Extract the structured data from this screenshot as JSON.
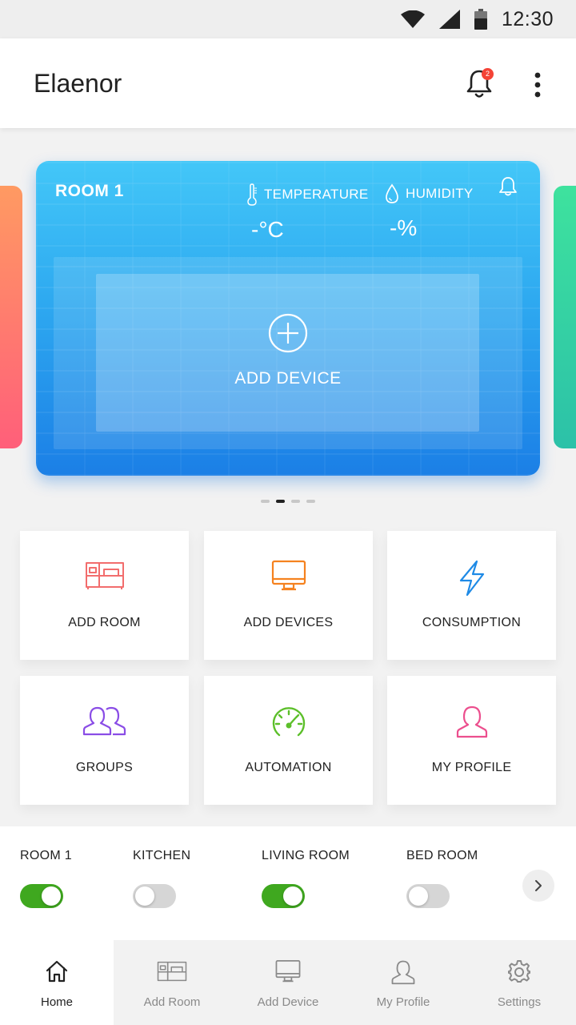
{
  "status_bar": {
    "time": "12:30",
    "icons": [
      "wifi-icon",
      "signal-icon",
      "battery-icon"
    ]
  },
  "app_bar": {
    "title": "Elaenor",
    "notification_count": "2"
  },
  "room_card": {
    "name": "ROOM 1",
    "temperature_label": "TEMPERATURE",
    "temperature_value": "-°C",
    "humidity_label": "HUMIDITY",
    "humidity_value": "-%",
    "add_device_label": "ADD DEVICE"
  },
  "carousel": {
    "pages": 4,
    "active_index": 1
  },
  "tiles": [
    {
      "label": "ADD ROOM",
      "icon": "bed-icon",
      "color": "#f26d6d"
    },
    {
      "label": "ADD DEVICES",
      "icon": "monitor-icon",
      "color": "#f5821f"
    },
    {
      "label": "CONSUMPTION",
      "icon": "lightning-icon",
      "color": "#1e8ae6"
    },
    {
      "label": "GROUPS",
      "icon": "group-icon",
      "color": "#8a4de6"
    },
    {
      "label": "AUTOMATION",
      "icon": "speedometer-icon",
      "color": "#5cbf2a"
    },
    {
      "label": "MY PROFILE",
      "icon": "user-icon",
      "color": "#ec4f8e"
    }
  ],
  "room_toggles": [
    {
      "label": "ROOM 1",
      "on": true
    },
    {
      "label": "KITCHEN",
      "on": false
    },
    {
      "label": "LIVING ROOM",
      "on": true
    },
    {
      "label": "BED ROOM",
      "on": false
    }
  ],
  "bottom_nav": [
    {
      "label": "Home",
      "icon": "home-icon",
      "active": true
    },
    {
      "label": "Add Room",
      "icon": "bed-icon",
      "active": false
    },
    {
      "label": "Add Device",
      "icon": "monitor-icon",
      "active": false
    },
    {
      "label": "My Profile",
      "icon": "user-icon",
      "active": false
    },
    {
      "label": "Settings",
      "icon": "gear-icon",
      "active": false
    }
  ],
  "colors": {
    "card_top": "#43c7f8",
    "card_bottom": "#1b7fe6",
    "toggle_on": "#3fa81f",
    "badge": "#f44336"
  }
}
